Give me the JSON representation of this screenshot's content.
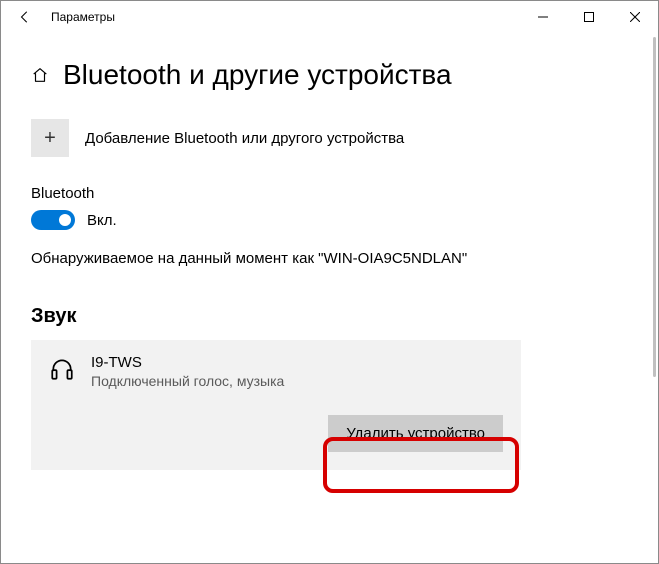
{
  "window": {
    "title": "Параметры"
  },
  "page": {
    "heading": "Bluetooth и другие устройства"
  },
  "add_device": {
    "label": "Добавление Bluetooth или другого устройства"
  },
  "bluetooth": {
    "label": "Bluetooth",
    "state_label": "Вкл.",
    "on": true,
    "discoverable_text": "Обнаруживаемое на данный момент как \"WIN-OIA9C5NDLAN\""
  },
  "sections": {
    "audio": {
      "heading": "Звук",
      "devices": [
        {
          "name": "I9-TWS",
          "status": "Подключенный голос, музыка",
          "remove_label": "Удалить устройство"
        }
      ]
    }
  },
  "colors": {
    "accent": "#0078d7",
    "highlight": "#d60000"
  }
}
